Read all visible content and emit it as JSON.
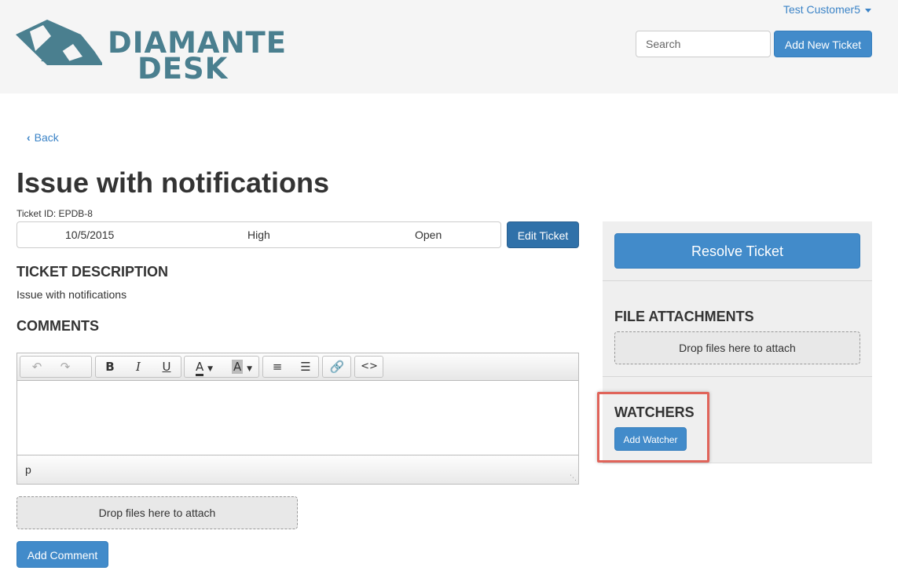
{
  "header": {
    "logo_text_line1": "DIAMANTE",
    "logo_text_line2": "DESK",
    "user_name": "Test Customer5",
    "search_placeholder": "Search",
    "add_ticket_label": "Add New Ticket",
    "brand_color": "#4a7f8f"
  },
  "nav": {
    "back_label": "Back"
  },
  "ticket": {
    "title": "Issue with notifications",
    "id_label": "Ticket ID: EPDB-8",
    "date": "10/5/2015",
    "priority": "High",
    "status": "Open",
    "edit_label": "Edit Ticket"
  },
  "description": {
    "heading": "TICKET DESCRIPTION",
    "text": "Issue with notifications"
  },
  "comments": {
    "heading": "COMMENTS",
    "toolbar_icons": [
      "undo-icon",
      "redo-icon",
      "bold-icon",
      "italic-icon",
      "underline-icon",
      "text-color-icon",
      "background-color-icon",
      "bullet-list-icon",
      "numbered-list-icon",
      "link-icon",
      "code-icon"
    ],
    "status_path": "p",
    "dropzone_label": "Drop files here to attach",
    "add_comment_label": "Add Comment"
  },
  "sidebar": {
    "resolve_label": "Resolve Ticket",
    "attachments_heading": "FILE ATTACHMENTS",
    "attachments_dropzone": "Drop files here to attach",
    "watchers_heading": "WATCHERS",
    "add_watcher_label": "Add Watcher",
    "highlight_color": "#e0645a"
  },
  "colors": {
    "primary": "#428bca",
    "link": "#3c84c7",
    "header_bg": "#f5f5f5"
  }
}
